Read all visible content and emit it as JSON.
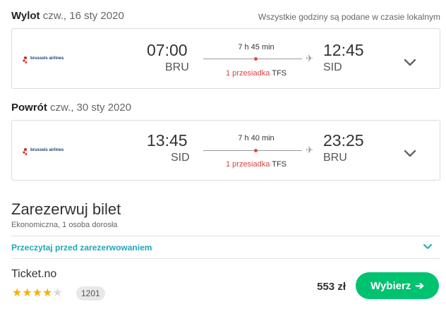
{
  "note": "Wszystkie godziny są podane w czasie lokalnym",
  "outbound": {
    "label": "Wylot",
    "date": "czw., 16 sty 2020",
    "airline": "brussels airlines",
    "dep_time": "07:00",
    "dep_code": "BRU",
    "duration": "7 h 45 min",
    "stops": "1 przesiadka",
    "stop_airport": "TFS",
    "arr_time": "12:45",
    "arr_code": "SID"
  },
  "return": {
    "label": "Powrót",
    "date": "czw., 30 sty 2020",
    "airline": "brussels airlines",
    "dep_time": "13:45",
    "dep_code": "SID",
    "duration": "7 h 40 min",
    "stops": "1 przesiadka",
    "stop_airport": "TFS",
    "arr_time": "23:25",
    "arr_code": "BRU"
  },
  "booking": {
    "title": "Zarezerwuj bilet",
    "subtitle": "Ekonomiczna, 1 osoba dorosła",
    "read_link": "Przeczytaj przed zarezerwowaniem",
    "provider": "Ticket.no",
    "rating": 4,
    "rating_max": 5,
    "reviews": "1201",
    "price": "553 zł",
    "choose_label": "Wybierz"
  },
  "colors": {
    "accent_green": "#00c26f",
    "link_teal": "#1fa8b8",
    "stop_red": "#e0403f",
    "star_gold": "#f5b200"
  }
}
